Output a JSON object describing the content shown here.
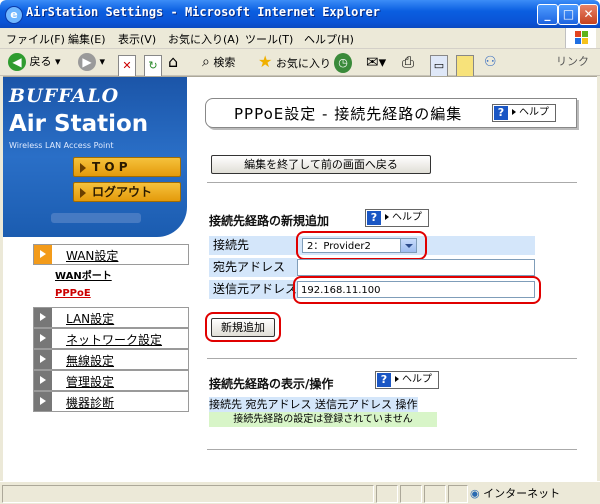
{
  "window": {
    "title": "AirStation Settings - Microsoft Internet Explorer"
  },
  "menu": [
    "ファイル(F)",
    "編集(E)",
    "表示(V)",
    "お気に入り(A)",
    "ツール(T)",
    "ヘルプ(H)"
  ],
  "toolbar": {
    "back": "戻る",
    "search": "検索",
    "favorites": "お気に入り",
    "links": "リンク"
  },
  "sidebar": {
    "brand": "BUFFALO",
    "product": "Air Station",
    "tagline": "Wireless LAN Access Point",
    "top_button": "T O P",
    "logout_button": "ログアウト",
    "nav": [
      {
        "label": "WAN設定",
        "active": true
      },
      {
        "label": "LAN設定",
        "active": false
      },
      {
        "label": "ネットワーク設定",
        "active": false
      },
      {
        "label": "無線設定",
        "active": false
      },
      {
        "label": "管理設定",
        "active": false
      },
      {
        "label": "機器診断",
        "active": false
      }
    ],
    "sub": [
      {
        "label": "WANポート"
      },
      {
        "label": "PPPoE",
        "color": "#cc0000"
      }
    ]
  },
  "main": {
    "page_title": "PPPoE設定 - 接続先経路の編集",
    "help": "ヘルプ",
    "back_button": "編集を終了して前の画面へ戻る",
    "add_section": {
      "title": "接続先経路の新規追加",
      "connection_label": "接続先",
      "connection_value": "2：Provider2",
      "dest_label": "宛先アドレス",
      "dest_value": "",
      "src_label": "送信元アドレス",
      "src_value": "192.168.11.100",
      "add_button": "新規追加"
    },
    "list_section": {
      "title": "接続先経路の表示/操作",
      "columns": [
        "接続先",
        "宛先アドレス",
        "送信元アドレス",
        "操作"
      ],
      "empty_message": "接続先経路の設定は登録されていません"
    }
  },
  "status": {
    "zone": "インターネット"
  },
  "colors": {
    "title_bar": "#0a5ee0",
    "sidebar": "#1b5cb0",
    "orange": "#f39b1a",
    "highlight": "#e00000",
    "label_bg": "#d4e6fa"
  }
}
